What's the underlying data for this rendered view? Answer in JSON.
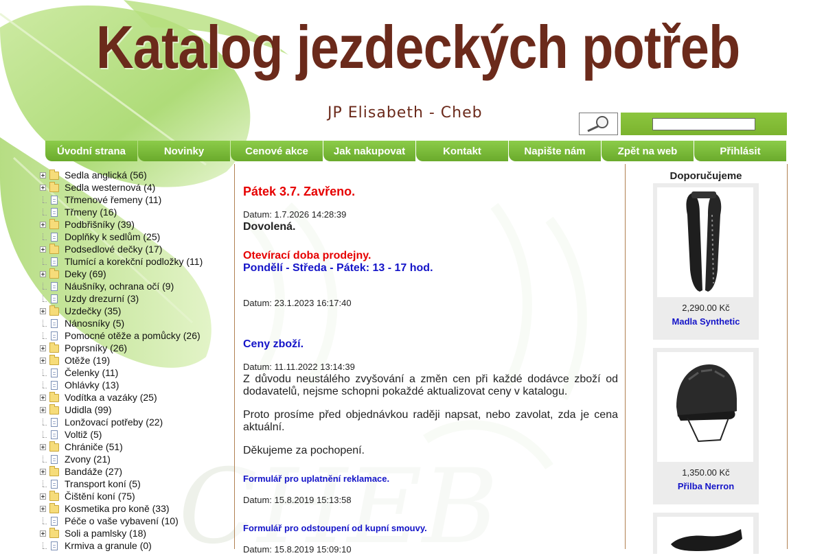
{
  "header": {
    "title": "Katalog jezdeckých potřeb",
    "subtitle": "JP Elisabeth - Cheb"
  },
  "search": {
    "value": "",
    "placeholder": ""
  },
  "nav": [
    "Úvodní strana",
    "Novinky",
    "Cenové akce",
    "Jak nakupovat",
    "Kontakt",
    "Napište nám",
    "Zpět na web",
    "Přihlásit"
  ],
  "categories": [
    {
      "label": "Sedla anglická (56)",
      "type": "folder"
    },
    {
      "label": "Sedla westernová (4)",
      "type": "folder"
    },
    {
      "label": "Třmenové řemeny (11)",
      "type": "doc"
    },
    {
      "label": "Třmeny (16)",
      "type": "doc"
    },
    {
      "label": "Podbřišníky (39)",
      "type": "folder"
    },
    {
      "label": "Doplňky k sedlům (25)",
      "type": "doc"
    },
    {
      "label": "Podsedlové dečky (17)",
      "type": "folder"
    },
    {
      "label": "Tlumící a korekční podložky (11)",
      "type": "doc"
    },
    {
      "label": "Deky (69)",
      "type": "folder"
    },
    {
      "label": "Náušníky, ochrana očí (9)",
      "type": "doc"
    },
    {
      "label": "Uzdy drezurní (3)",
      "type": "doc"
    },
    {
      "label": "Uzdečky (35)",
      "type": "folder"
    },
    {
      "label": "Nánosníky (5)",
      "type": "doc"
    },
    {
      "label": "Pomocné otěže a pomůcky (26)",
      "type": "doc"
    },
    {
      "label": "Poprsníky (26)",
      "type": "folder"
    },
    {
      "label": "Otěže (19)",
      "type": "folder"
    },
    {
      "label": "Čelenky (11)",
      "type": "doc"
    },
    {
      "label": "Ohlávky (13)",
      "type": "doc"
    },
    {
      "label": "Vodítka a vazáky (25)",
      "type": "folder"
    },
    {
      "label": "Udidla (99)",
      "type": "folder"
    },
    {
      "label": "Lonžovací potřeby (22)",
      "type": "doc"
    },
    {
      "label": "Voltiž (5)",
      "type": "doc"
    },
    {
      "label": "Chrániče (51)",
      "type": "folder"
    },
    {
      "label": "Zvony (21)",
      "type": "doc"
    },
    {
      "label": "Bandáže (27)",
      "type": "folder"
    },
    {
      "label": "Transport koní (5)",
      "type": "doc"
    },
    {
      "label": "Čištění koní (75)",
      "type": "folder"
    },
    {
      "label": "Kosmetika pro koně (33)",
      "type": "folder"
    },
    {
      "label": "Péče o vaše vybavení (10)",
      "type": "doc"
    },
    {
      "label": "Soli a pamlsky (18)",
      "type": "folder"
    },
    {
      "label": "Krmiva a granule (0)",
      "type": "doc"
    }
  ],
  "news": {
    "n1_title": "Pátek 3.7. Zavřeno.",
    "n1_date": "Datum: 1.7.2026 14:28:39",
    "n1_text": "Dovolená.",
    "n2_line1": "Otevírací doba prodejny.",
    "n2_line2": "Pondělí - Středa - Pátek: 13 - 17 hod.",
    "n2_date": "Datum: 23.1.2023 16:17:40",
    "n3_title": "Ceny zboží.",
    "n3_date": "Datum: 11.11.2022 13:14:39",
    "n3_p1": "Z důvodu neustálého zvyšování a změn cen při každé dodávce zboží od dodavatelů, nejsme schopni pokaždé aktualizovat ceny v katalogu.",
    "n3_p2": "Proto prosíme před objednávkou raději napsat, nebo zavolat, zda je cena aktuální.",
    "n3_p3": "Děkujeme za pochopení.",
    "n4_link": "Formulář pro uplatnění reklamace.",
    "n4_date": "Datum: 15.8.2019 15:13:58",
    "n5_link": "Formulář pro odstoupení od kupní smouvy.",
    "n5_date": "Datum: 15.8.2019 15:09:10"
  },
  "recommended": {
    "title": "Doporučujeme",
    "items": [
      {
        "price": "2,290.00 Kč",
        "name": "Madla Synthetic",
        "icon": "chaps-image"
      },
      {
        "price": "1,350.00 Kč",
        "name": "Přilba Nerron",
        "icon": "helmet-image"
      },
      {
        "price": "",
        "name": "",
        "icon": "saddle-image"
      }
    ]
  }
}
